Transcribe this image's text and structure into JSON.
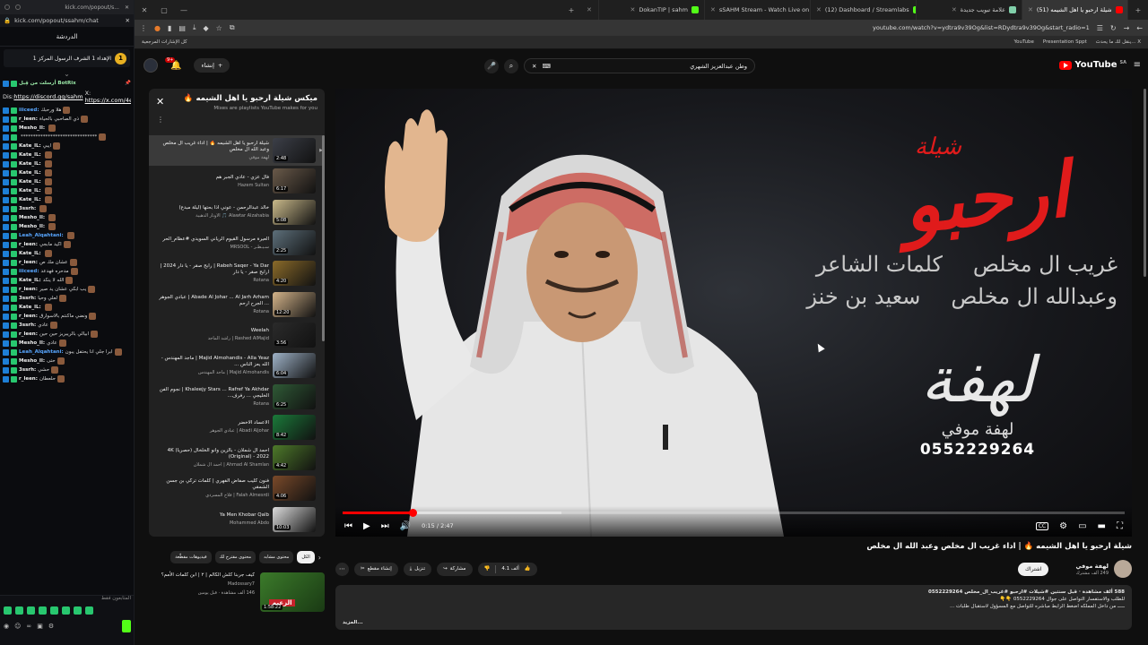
{
  "chat": {
    "titlebar_url": "kick.com/popout/s...",
    "url": "kick.com/popout/ssahm/chat",
    "header": "الدردشة",
    "pinned_num": "1",
    "pinned_text": "الإهداء 1 الشرف الرسول المركز 1",
    "bot_line": "أرسلت من قِبل BotRix",
    "discord_label": "Dis:",
    "discord_url": "https://discord.gg/sahm",
    "x_label": "X:",
    "x_url": "https://x.com/4e56",
    "messages": [
      {
        "user": "iiiceed:",
        "text": "هلا ورحبك",
        "cls": "blue"
      },
      {
        "user": "r_leen:",
        "text": "ذي الصاحبي بالحياة",
        "cls": "white"
      },
      {
        "user": "Mesho_Il:",
        "text": "",
        "cls": "white"
      },
      {
        "user": "",
        "text": "*******************************",
        "cls": "white"
      },
      {
        "user": "Kate_lL:",
        "text": "ايبي",
        "cls": "white"
      },
      {
        "user": "Kate_lL:",
        "text": "",
        "cls": "white"
      },
      {
        "user": "Kate_lL:",
        "text": "",
        "cls": "white"
      },
      {
        "user": "Kate_lL:",
        "text": "",
        "cls": "white"
      },
      {
        "user": "Kate_lL:",
        "text": "",
        "cls": "white"
      },
      {
        "user": "Kate_lL:",
        "text": "",
        "cls": "white"
      },
      {
        "user": "Kate_lL:",
        "text": "",
        "cls": "white"
      },
      {
        "user": "3ssrh:",
        "text": "",
        "cls": "white"
      },
      {
        "user": "Mesho_Il:",
        "text": "",
        "cls": "white"
      },
      {
        "user": "Mesho_Il:",
        "text": "",
        "cls": "white"
      },
      {
        "user": "Leah_Alqahtani:",
        "text": "",
        "cls": "blue"
      },
      {
        "user": "r_leen:",
        "text": "اكيد مابجي",
        "cls": "white"
      },
      {
        "user": "Kate_lL:",
        "text": "",
        "cls": "white"
      },
      {
        "user": "r_leen:",
        "text": "عشان مك ص",
        "cls": "white"
      },
      {
        "user": "iiiceed:",
        "text": "مدحره فهدعد",
        "cls": "blue"
      },
      {
        "user": "Kate_lL:",
        "text": "الله لا ينكد",
        "cls": "white"
      },
      {
        "user": "r_leen:",
        "text": "يب ابكي عشان يد صير",
        "cls": "white"
      },
      {
        "user": "3ssrh:",
        "text": "لعلي وحيا",
        "cls": "white"
      },
      {
        "user": "Kate_lL:",
        "text": "",
        "cls": "white"
      },
      {
        "user": "r_leen:",
        "text": "ونضي ماكنتم بالاسوارق",
        "cls": "white"
      },
      {
        "user": "3ssrh:",
        "text": "عادي",
        "cls": "white"
      },
      {
        "user": "r_leen:",
        "text": "ابيالي بالريبريز حين حين",
        "cls": "white"
      },
      {
        "user": "Mesho_Il:",
        "text": "عادي",
        "cls": "white"
      },
      {
        "user": "Leah_Alqahtani:",
        "text": "ابرا جلي انا يحتفل يبون",
        "cls": "blue"
      },
      {
        "user": "Mesho_Il:",
        "text": "حتى",
        "cls": "white"
      },
      {
        "user": "3ssrh:",
        "text": "حشي",
        "cls": "white"
      },
      {
        "user": "r_leen:",
        "text": "حلعطان",
        "cls": "white"
      }
    ],
    "status": "المتابعون فقط"
  },
  "browser": {
    "tabs": [
      {
        "label": "",
        "color": "#ff5f1f",
        "active": false
      },
      {
        "label": "DokanTIP | sahm",
        "color": "#53fc18",
        "active": false
      },
      {
        "label": "sSAHM Stream - Watch Live on",
        "color": "#ffb000",
        "active": false
      },
      {
        "label": "(12) Dashboard / Streamlabs",
        "color": "#53fc18",
        "active": false
      },
      {
        "label": "علامة تبويب جديدة",
        "color": "#80cfa9",
        "active": false
      },
      {
        "label": "(51) شيلة ارحبو يا اهل الشيمه",
        "color": "#ff0000",
        "active": true
      }
    ],
    "url": "youtube.com/watch?v=ydtra9v39Og&list=RDydtra9v39Og&start_radio=1",
    "bookmarks_left": "كل الإشارات المرجعية",
    "bookmarks_right": [
      "YouTube",
      "Presentation Sppt",
      "ينقل لك ما يحدث... X"
    ]
  },
  "youtube": {
    "create_label": "إنشاء",
    "notif_count": "9+",
    "search_query": "وطن عبدالعزيز الشهري",
    "logo_text": "YouTube",
    "logo_cc": "SA",
    "artwork": {
      "small_title": "شيلة",
      "big_title": "ارحبو",
      "line1a": "غريب ال مخلص",
      "line1b": "كلمات الشاعر",
      "line2a": "وعبدالله ال مخلص",
      "line2b": "سعيد بن خنز",
      "logo_name": "لهفة موفي",
      "phone": "0552229264"
    },
    "player": {
      "time": "0:15 / 2:47",
      "progress_fraction": 0.09,
      "buffer_fraction": 0.28
    },
    "playlist": {
      "title": "ميكس شيلة ارحبو يا اهل الشيمه 🔥",
      "subtitle": "Mixes are playlists YouTube makes for you",
      "items": [
        {
          "title": "شيلة ارحبو يا اهل الشيمه 🔥 | اداء غريب ال مخلص وعبد الله ال مخلص",
          "channel": "لهفة موفي",
          "dur": "2:48",
          "color": "#3c3f48",
          "active": true
        },
        {
          "title": "فال عزي - عادي الجبر هم",
          "channel": "Hazem Sultan",
          "dur": "6:17",
          "color": "#6a5a4a"
        },
        {
          "title": "خالد عبدالرحمن - عوني اذا بحتها (ليلة مبدع)",
          "channel": "Alawtar Alzahabia 🎵 الأوتار الذهبية",
          "dur": "5:08",
          "color": "#c9b98a"
        },
        {
          "title": "العيرة مرسول القيوم الرياني السويدي #عظام_الحر",
          "channel": "سـيـطـر - MRSOOL",
          "dur": "2:25",
          "color": "#5d6f7a"
        },
        {
          "title": "Rabeh Saqer - Ya Dar | رابح صقر - يا دار 2024 | ارابح صقر - يا دار",
          "channel": "Rotana",
          "dur": "4:20",
          "color": "#8b6b2a"
        },
        {
          "title": "Abade Al Johar ... Al Jarh Arham | عبادي الجوهر ... الجرح ارحم",
          "channel": "Rotana",
          "dur": "12:20",
          "color": "#d4b48a"
        },
        {
          "title": "Weelah",
          "channel": "Rashed AlMajid | راشد الماجد",
          "dur": "3:56",
          "color": "#2b2b2b"
        },
        {
          "title": "Majid Almohandis - Alla Yeaz | ماجد المهندس - الله يعز الناس ...",
          "channel": "Majid Almohandis | ماجد المهندس",
          "dur": "6:04",
          "color": "#9fb3c8"
        },
        {
          "title": "Khaleejy Stars ... Rafref Ya Akhdar | نجوم الفن الخليجي ... رفرف...",
          "channel": "Rotana",
          "dur": "6:25",
          "color": "#2f5a36"
        },
        {
          "title": "الاعساد الاخضر",
          "channel": "Abadi Aljohar | عبادي الجوهر",
          "dur": "8:42",
          "color": "#1b7a3a"
        },
        {
          "title": "احمد ال شملان - بالزين وانو الخلخال (حصرياً) 4K (Original) - 2022",
          "channel": "Ahmad Al Shamlan | احمد ال شملان",
          "dur": "4:42",
          "color": "#4e7a2a"
        },
        {
          "title": "فنون كليب صفاض الفهري | كلمات تركي بن جسن الشمقي",
          "channel": "Falah Almesrdi | فلاح المسردي",
          "dur": "4:06",
          "color": "#7a4a2a"
        },
        {
          "title": "Ya Men Khobar Qalb",
          "channel": "Mohammed Abdo",
          "dur": "10:03",
          "color": "#dcdcdc"
        },
        {
          "title": "...",
          "channel": "",
          "dur": "",
          "color": "#444"
        }
      ]
    },
    "chips": [
      "الكل",
      "محتوى مشابه",
      "محتوى مقترح لك",
      "فيديوهات مقطّعة"
    ],
    "rec": {
      "title": "كيف جربنا كلش الكالم | ٢ | ابن كلمات الأمم؟",
      "channel": "Madossary7",
      "views": "146 ألف مشاهدة · قبل يومين",
      "dur": "1:58:22",
      "thumb_label": "الزعيم"
    },
    "video": {
      "title": "شيلة ارحبو يا اهل الشيمه 🔥 | اداء غريب ال مخلص وعبد الله ال مخلص",
      "channel": "لهفة موفي",
      "subs": "249 ألف مشترك",
      "subscribe": "اشتراك",
      "likes": "4.1 ألف",
      "share": "مشاركة",
      "download": "تنزيل",
      "clip": "إنشاء مقطع",
      "desc_stats": "588 ألف مشاهدة · قبل سنتين #شيلات #ارحبو #غريب_ال_مخلص 0552229264",
      "desc_line2": "للطلب والاستفسار التواصل على جوال 0552229264 👇👇",
      "desc_line3": "ـــــ من داخل المملكه اضغط الرابط مباشره للتواصل مع المسؤول لاستقبال طلبات ...",
      "desc_more": "...المزيد"
    }
  }
}
